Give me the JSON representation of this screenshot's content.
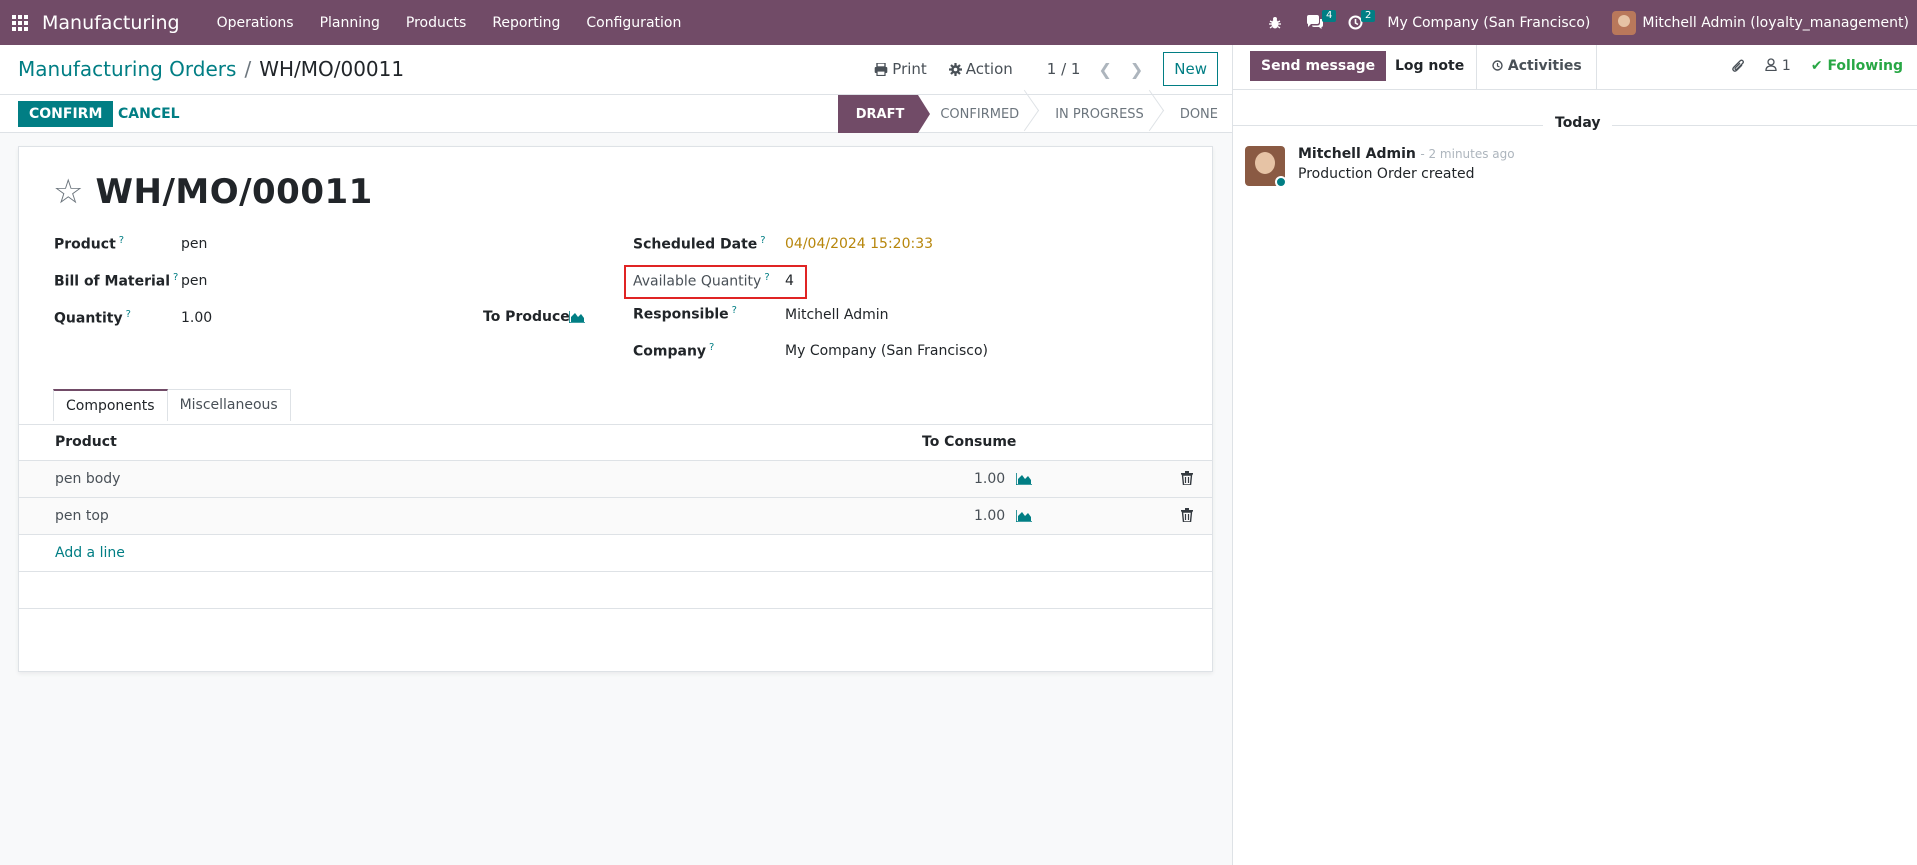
{
  "navbar": {
    "brand": "Manufacturing",
    "menu": [
      "Operations",
      "Planning",
      "Products",
      "Reporting",
      "Configuration"
    ],
    "messages_count": "4",
    "activities_count": "2",
    "company": "My Company (San Francisco)",
    "user": "Mitchell Admin (loyalty_management)"
  },
  "breadcrumb": {
    "parent": "Manufacturing Orders",
    "current": "WH/MO/00011"
  },
  "control": {
    "print_label": "Print",
    "action_label": "Action",
    "pager": "1 / 1",
    "new_label": "New"
  },
  "status": {
    "confirm_label": "CONFIRM",
    "cancel_label": "CANCEL",
    "stages": [
      "DRAFT",
      "CONFIRMED",
      "IN PROGRESS",
      "DONE"
    ]
  },
  "form": {
    "title": "WH/MO/00011",
    "product_label": "Product",
    "product_value": "pen",
    "bom_label": "Bill of Material",
    "bom_value": "pen",
    "quantity_label": "Quantity",
    "quantity_value": "1.00",
    "to_produce_label": "To Produce",
    "scheduled_label": "Scheduled Date",
    "scheduled_value": "04/04/2024 15:20:33",
    "available_label": "Available Quantity",
    "available_value": "4",
    "responsible_label": "Responsible",
    "responsible_value": "Mitchell Admin",
    "company_label": "Company",
    "company_value": "My Company (San Francisco)",
    "help_mark": "?"
  },
  "notebook": {
    "tabs": [
      "Components",
      "Miscellaneous"
    ],
    "headers": {
      "product": "Product",
      "to_consume": "To Consume"
    },
    "rows": [
      {
        "product": "pen body",
        "qty": "1.00"
      },
      {
        "product": "pen top",
        "qty": "1.00"
      }
    ],
    "add_line": "Add a line"
  },
  "chatter": {
    "send_label": "Send message",
    "log_label": "Log note",
    "activities_label": "Activities",
    "followers_count": "1",
    "following_label": "Following",
    "today": "Today",
    "message": {
      "author": "Mitchell Admin",
      "date": "- 2 minutes ago",
      "body": "Production Order created"
    }
  },
  "colors": {
    "brand_purple": "#714b67",
    "teal_accent": "#017e84",
    "date_highlight": "#b7860b",
    "highlight_border": "#e02424",
    "following_green": "#28a745"
  }
}
